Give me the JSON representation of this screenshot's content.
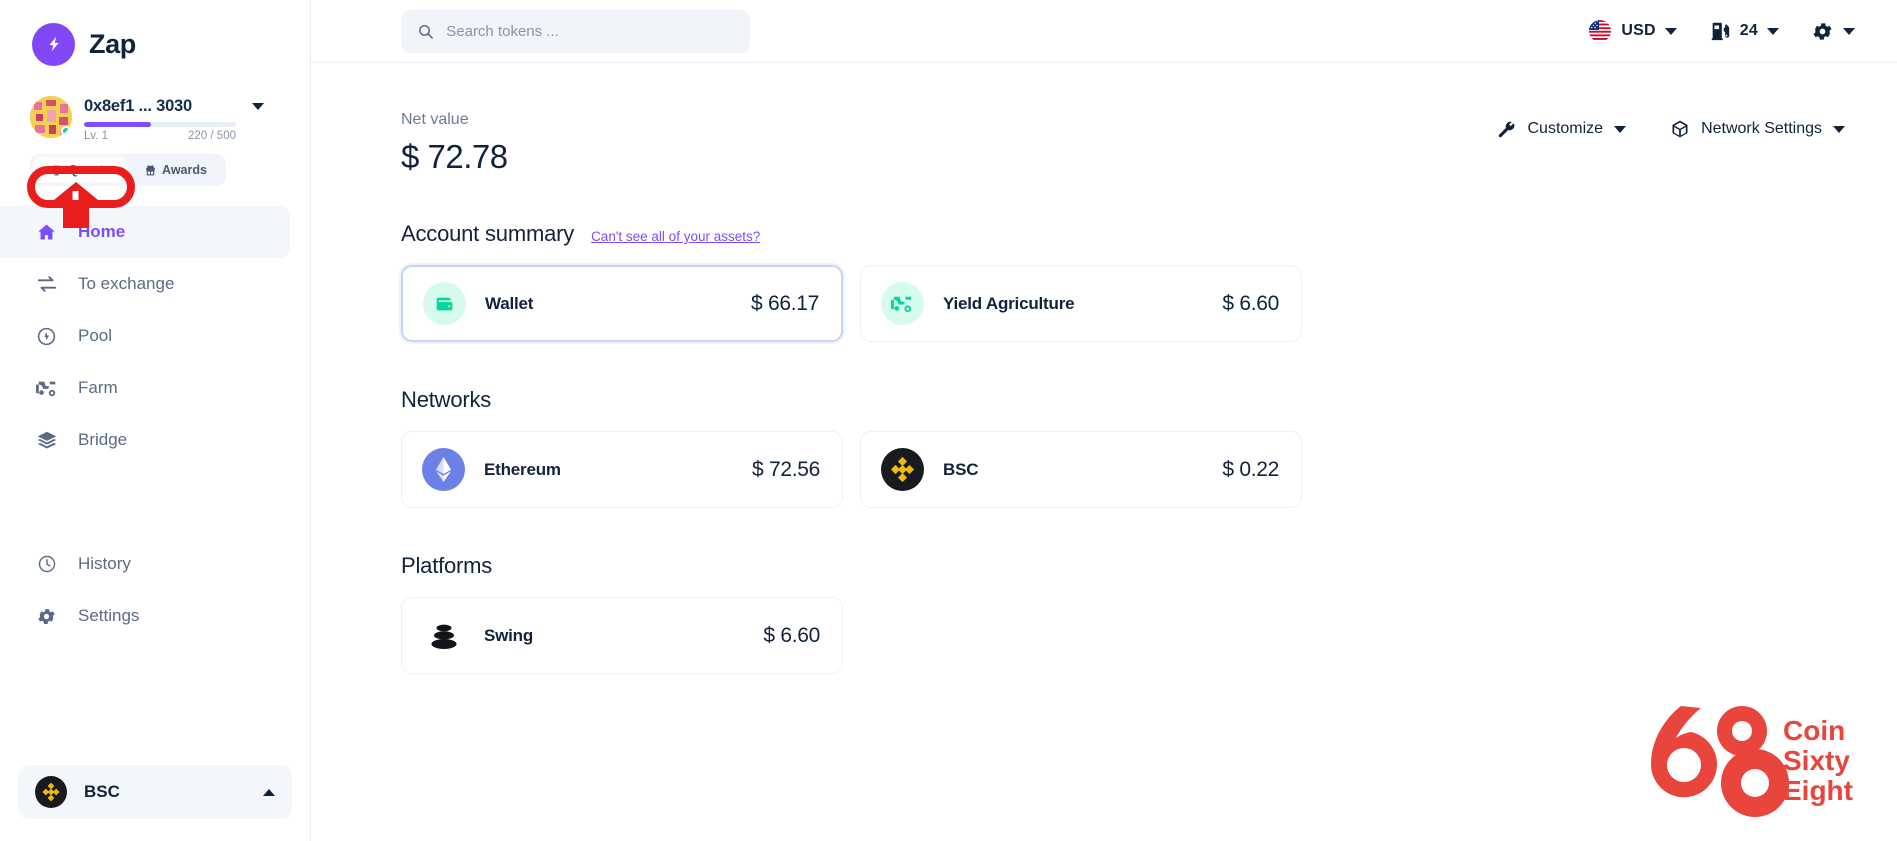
{
  "brand": {
    "name": "Zap",
    "logo_icon": "zap-bolt-icon"
  },
  "account": {
    "address": "0x8ef1 ... 3030",
    "level": "Lv. 1",
    "xp": "220 / 500",
    "xp_percent": 44,
    "dropdown_icon": "chevron-down-icon",
    "tabs": [
      {
        "label": "Quests",
        "icon": "trophy-icon",
        "active": true
      },
      {
        "label": "Awards",
        "icon": "gift-icon",
        "active": false
      }
    ]
  },
  "sidebar": {
    "items": [
      {
        "label": "Home",
        "icon": "home-icon",
        "active": true
      },
      {
        "label": "To exchange",
        "icon": "swap-arrows-icon",
        "active": false
      },
      {
        "label": "Pool",
        "icon": "droplet-icon",
        "active": false
      },
      {
        "label": "Farm",
        "icon": "tractor-icon",
        "active": false
      },
      {
        "label": "Bridge",
        "icon": "layers-icon",
        "active": false
      }
    ],
    "bottom_items": [
      {
        "label": "History",
        "icon": "clock-icon",
        "active": false
      },
      {
        "label": "Settings",
        "icon": "gear-icon",
        "active": false
      }
    ],
    "network_switcher": {
      "label": "BSC",
      "icon": "binance-coin-icon",
      "caret_icon": "chevron-up-icon"
    }
  },
  "topbar": {
    "search": {
      "placeholder": "Search tokens ...",
      "value": "",
      "icon": "search-icon"
    },
    "currency": {
      "label": "USD",
      "icon": "us-flag-icon",
      "caret_icon": "chevron-down-icon"
    },
    "gas": {
      "label": "24",
      "icon": "gas-pump-icon",
      "caret_icon": "chevron-down-icon"
    },
    "settings": {
      "icon": "gear-icon",
      "caret_icon": "chevron-down-icon"
    }
  },
  "main": {
    "net_value_label": "Net value",
    "net_value_amount": "$ 72.78",
    "actions": [
      {
        "label": "Customize",
        "icon": "wrench-icon",
        "caret_icon": "chevron-down-icon"
      },
      {
        "label": "Network Settings",
        "icon": "cube-icon",
        "caret_icon": "chevron-down-icon"
      }
    ],
    "account_summary": {
      "title": "Account summary",
      "link": "Can't see all of your assets?",
      "cards": [
        {
          "name": "Wallet",
          "amount": "$ 66.17",
          "icon": "wallet-icon",
          "selected": true
        },
        {
          "name": "Yield Agriculture",
          "amount": "$ 6.60",
          "icon": "tractor-icon",
          "selected": false
        }
      ]
    },
    "networks": {
      "title": "Networks",
      "cards": [
        {
          "name": "Ethereum",
          "amount": "$ 72.56",
          "icon": "ethereum-icon"
        },
        {
          "name": "BSC",
          "amount": "$ 0.22",
          "icon": "binance-coin-icon"
        }
      ]
    },
    "platforms": {
      "title": "Platforms",
      "cards": [
        {
          "name": "Swing",
          "amount": "$ 6.60",
          "icon": "swing-stones-icon"
        }
      ]
    }
  },
  "watermark": {
    "line1": "Coin",
    "line2": "Sixty",
    "line3": "Eight",
    "color": "#e8453c"
  },
  "annotation": {
    "type": "red-highlight-ring-with-arrow",
    "target": "Quests",
    "color": "#ea1d1d"
  },
  "colors": {
    "accent_purple": "#7c4dff",
    "text_dark": "#11233c",
    "text_muted": "#6b7a94",
    "mint": "#06d6a0",
    "binance_yellow": "#f0b90b",
    "annotation_red": "#ea1d1d"
  }
}
